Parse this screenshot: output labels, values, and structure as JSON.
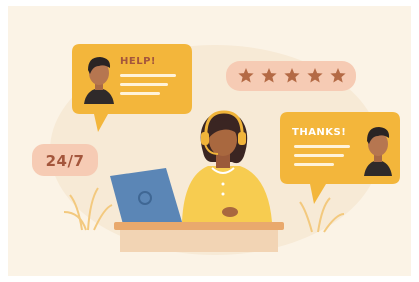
{
  "illustration": {
    "help_bubble": {
      "text": "HELP!"
    },
    "thanks_bubble": {
      "text": "THANKS!"
    },
    "availability_badge": {
      "text": "24/7"
    },
    "rating": {
      "stars": 5,
      "max_stars": 5
    }
  },
  "colors": {
    "background": "#fbf3e6",
    "bubble_yellow": "#f3b63b",
    "bubble_dark": "#e09b22",
    "pink_badge": "#f6cbb4",
    "star_brown": "#b46a45",
    "laptop_blue": "#5b86b6",
    "desk_orange": "#e9a96d",
    "shirt_yellow": "#f7cc50",
    "text_brown": "#a4563c"
  }
}
